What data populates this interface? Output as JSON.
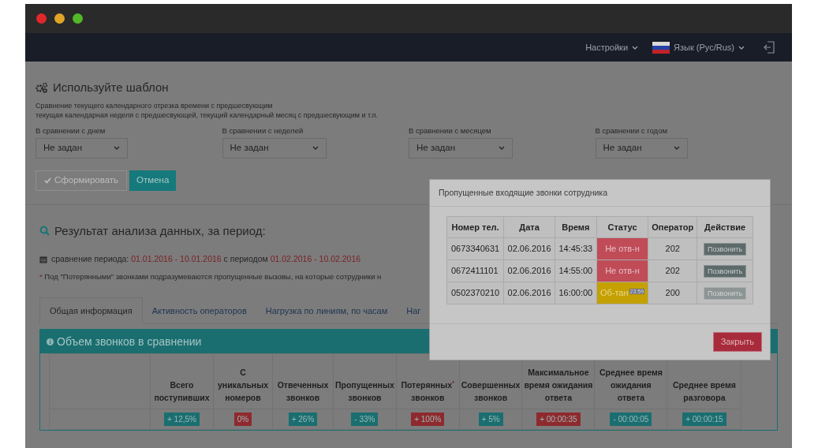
{
  "window": {
    "dots": [
      {
        "color": "#e0282b"
      },
      {
        "color": "#e0a526"
      },
      {
        "color": "#52b827"
      }
    ]
  },
  "navbar": {
    "items": [
      {
        "label": "Настройки",
        "kind": "dropdown"
      },
      {
        "label": "Язык (Рус/Rus)",
        "kind": "language"
      }
    ]
  },
  "template": {
    "title": "Используйте шаблон",
    "description": [
      "Сравнение текущего календарного отрезка времени с предшесвующим",
      "текущая календарная неделя с предшесвующей, текущий календарный месяц с предшесвующим и т.п."
    ],
    "filters": [
      {
        "label": "В сравнении с днем",
        "value": "Не задан"
      },
      {
        "label": "В сравнении с неделей",
        "value": "Не задан"
      },
      {
        "label": "В сравнении с месяцем",
        "value": "Не задан"
      },
      {
        "label": "В сравнении с годом",
        "value": "Не задан"
      }
    ],
    "buttons": [
      {
        "label": "Сформировать",
        "kind": "submit",
        "disabled": true
      },
      {
        "label": "Отмена",
        "kind": "cancel",
        "disabled": false
      }
    ]
  },
  "results": {
    "title": "Результат анализа данных, за период:",
    "period": [
      {
        "text": "сравнение периода: ",
        "highlight": false
      },
      {
        "text": "01.01.2016 - 10.01.2016",
        "highlight": true
      },
      {
        "text": " с периодом ",
        "highlight": false
      },
      {
        "text": "01.02.2016 - 10.02.2016",
        "highlight": true
      }
    ],
    "note": {
      "mark": "*",
      "text": "Под \"Потерянными\" звонками подразумеваются пропущенные вызовы, на которые сотрудники н"
    }
  },
  "tabs": [
    {
      "label": "Общая информация",
      "selected": true
    },
    {
      "label": "Активность операторов",
      "selected": false
    },
    {
      "label": "Нагрузка по линиям, по часам",
      "selected": false
    },
    {
      "label": "Наг",
      "selected": false
    }
  ],
  "panel": {
    "title": "Объем звонков в сравнении",
    "columns": [
      "Всего поступивших",
      "С уникальных номеров",
      "Отвеченных звонков",
      "Пропущенных звонков",
      "Потерянных$^{*}$ звонков",
      "Совершенных звонков",
      "Максимальное время ожидания ответа",
      "Среднее время ожидания ответа",
      "Среднее время разговора"
    ],
    "rows": [
      {
        "cells": [
          {
            "text": "+ 12,5%",
            "color": "#1a6e70"
          },
          {
            "text": "0%",
            "color": "#8e2a2e"
          },
          {
            "text": "+ 26%",
            "color": "#1a6e70"
          },
          {
            "text": "- 33%",
            "color": "#1a6e70"
          },
          {
            "text": "+ 100%",
            "color": "#8e2a2e"
          },
          {
            "text": "+ 5%",
            "color": "#1a6e70"
          },
          {
            "text": "+ 00:00:35",
            "color": "#8e2a2e"
          },
          {
            "text": "- 00:00:05",
            "color": "#1a6e70"
          },
          {
            "text": "+ 00:00:15",
            "color": "#1a6e70"
          }
        ]
      }
    ]
  },
  "modal": {
    "title": "Пропущенные входящие звонки сотрудника",
    "columns": [
      "Номер тел.",
      "Дата",
      "Время",
      "Статус",
      "Оператор",
      "Действие"
    ],
    "rows": [
      {
        "phone": "0673340631",
        "date": "02.06.2016",
        "time": "14:45:33",
        "status": {
          "text": "Не отв-н",
          "kind": "missed"
        },
        "operator": "202",
        "action": {
          "label": "Позвонить",
          "disabled": false
        }
      },
      {
        "phone": "0672411101",
        "date": "02.06.2016",
        "time": "14:55:00",
        "status": {
          "text": "Не отв-н",
          "kind": "missed"
        },
        "operator": "202",
        "action": {
          "label": "Позвонить",
          "disabled": false
        }
      },
      {
        "phone": "0502370210",
        "date": "02.06.2016",
        "time": "16:00:00",
        "status": {
          "text": "Об-тан",
          "kind": "processed",
          "badge": "23:59"
        },
        "operator": "200",
        "action": {
          "label": "Позвонить",
          "disabled": true
        }
      }
    ],
    "close": "Закрыть"
  }
}
